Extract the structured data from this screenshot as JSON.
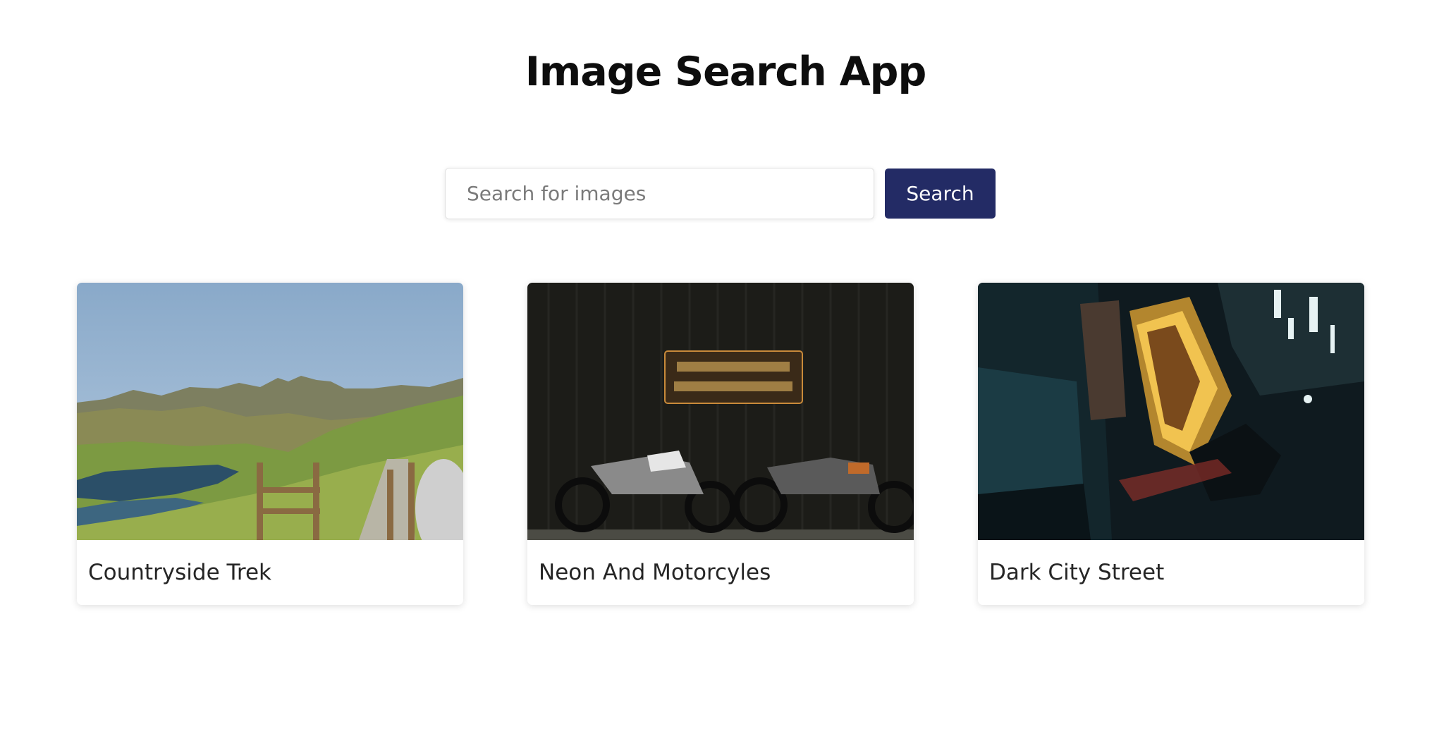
{
  "app": {
    "title": "Image Search App"
  },
  "search": {
    "placeholder": "Search for images",
    "value": "",
    "button_label": "Search",
    "button_color": "#232b65"
  },
  "results": [
    {
      "title": "Countryside Trek"
    },
    {
      "title": "Neon And Motorcyles"
    },
    {
      "title": "Dark City Street"
    }
  ]
}
